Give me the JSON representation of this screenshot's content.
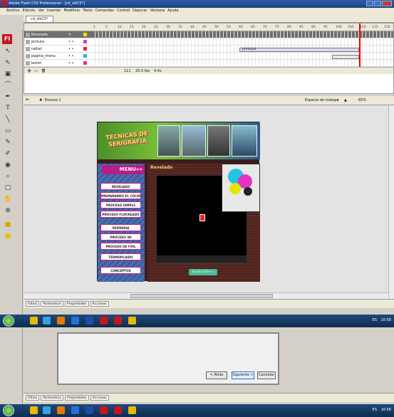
{
  "window": {
    "title": "Adobe Flash CS3 Professional - [cd_sikC5*]"
  },
  "menubar": [
    "Archivo",
    "Edición",
    "Ver",
    "Insertar",
    "Modificar",
    "Texto",
    "Comandos",
    "Control",
    "Depurar",
    "Ventana",
    "Ayuda"
  ],
  "document_tab": "cd_sikC5*",
  "timeline": {
    "layers": [
      {
        "name": "Revelado",
        "selected": true
      },
      {
        "name": "pintura",
        "selected": false
      },
      {
        "name": "radiat",
        "selected": false
      },
      {
        "name": "pagina_menu",
        "selected": false
      },
      {
        "name": "boton",
        "selected": false
      }
    ],
    "ruler": [
      "1",
      "5",
      "10",
      "15",
      "20",
      "25",
      "30",
      "35",
      "40",
      "45",
      "50",
      "55",
      "60",
      "65",
      "70",
      "75",
      "80",
      "85",
      "90",
      "95",
      "100",
      "105",
      "110",
      "115",
      "120"
    ],
    "frame_label": "principal",
    "current_frame": "111",
    "fps": "25.0 fps",
    "time": "4.4s"
  },
  "editbar": {
    "scene": "Escena 1",
    "workspace": "Espacio de trabajo",
    "zoom": "65%"
  },
  "swf": {
    "logo_line1": "TECNICAS DE",
    "logo_line2": "SERIGRAFIA",
    "menu_title": "MENU»»",
    "menu_items": [
      "REVELADO",
      "PREPARANDO EL COLOR",
      "PROCESO SIMPLE",
      "PROCESO FLOCKEADO",
      "PEDRERIA",
      "PROCESO 3D",
      "PROCESO DE FOIL",
      "TERMOPLIADO",
      "CONCEPTOS"
    ],
    "content_title": "Revelado",
    "explain_button": "Explicación»»"
  },
  "panel_tabs": [
    "Filtros",
    "Parámetros",
    "Propiedades",
    "Acciones"
  ],
  "taskbar": {
    "locale": "ES",
    "clock": "10:58"
  },
  "dialog": {
    "back": "< Atrás",
    "next": "Siguiente >",
    "cancel": "Cancelar"
  },
  "colors": {
    "accent": "#c9208d",
    "title_bar": "#2c5ea8",
    "swf_bg": "#3a1e1e",
    "playhead": "#ee0000"
  }
}
